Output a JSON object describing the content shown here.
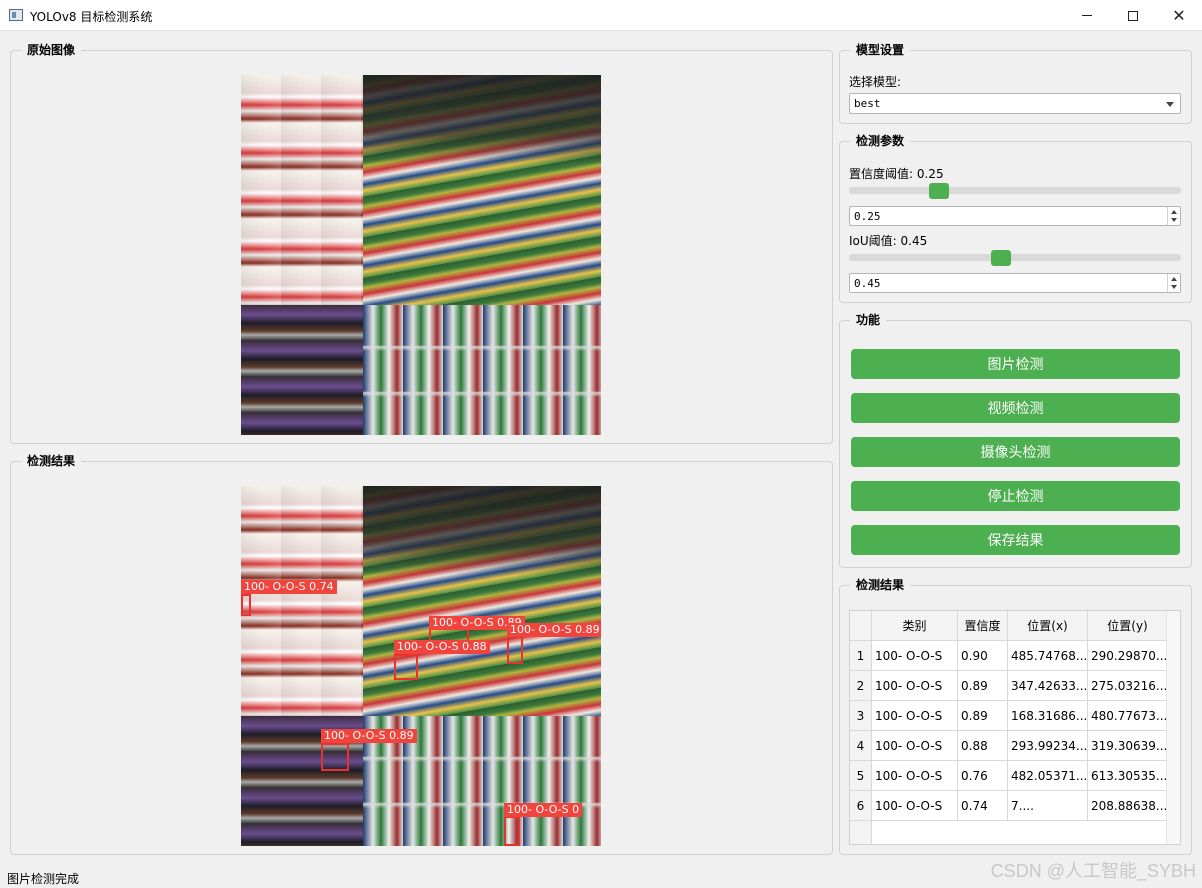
{
  "window": {
    "title": "YOLOv8 目标检测系统"
  },
  "original_image": {
    "title": "原始图像"
  },
  "result_image": {
    "title": "检测结果",
    "detections": [
      {
        "label": "100- O-O-S 0.74"
      },
      {
        "label": "100- O-O-S 0.89"
      },
      {
        "label": "100- O-O-S 0.88"
      },
      {
        "label": "100- O-O-S 0.89"
      },
      {
        "label": "100- O-O-S 0.89"
      },
      {
        "label": "100- O-O-S 0"
      }
    ]
  },
  "model_settings": {
    "title": "模型设置",
    "select_label": "选择模型:",
    "selected_model": "best"
  },
  "detection_params": {
    "title": "检测参数",
    "confidence": {
      "label": "置信度阈值: 0.25",
      "value": "0.25",
      "slider_fraction": 0.25
    },
    "iou": {
      "label": "IoU阈值: 0.45",
      "value": "0.45",
      "slider_fraction": 0.45
    }
  },
  "functions": {
    "title": "功能",
    "buttons": [
      "图片检测",
      "视频检测",
      "摄像头检测",
      "停止检测",
      "保存结果"
    ]
  },
  "results_table": {
    "title": "检测结果",
    "headers": [
      "类别",
      "置信度",
      "位置(x)",
      "位置(y)"
    ],
    "rows": [
      {
        "num": "1",
        "cls": "100- O-O-S",
        "conf": "0.90",
        "x": "485.74768...",
        "y": "290.29870..."
      },
      {
        "num": "2",
        "cls": "100- O-O-S",
        "conf": "0.89",
        "x": "347.42633...",
        "y": "275.03216..."
      },
      {
        "num": "3",
        "cls": "100- O-O-S",
        "conf": "0.89",
        "x": "168.31686...",
        "y": "480.77673..."
      },
      {
        "num": "4",
        "cls": "100- O-O-S",
        "conf": "0.88",
        "x": "293.99234...",
        "y": "319.30639..."
      },
      {
        "num": "5",
        "cls": "100- O-O-S",
        "conf": "0.76",
        "x": "482.05371...",
        "y": "613.30535..."
      },
      {
        "num": "6",
        "cls": "100- O-O-S",
        "conf": "0.74",
        "x": "7....",
        "y": "208.88638..."
      }
    ]
  },
  "status": {
    "text": "图片检测完成"
  },
  "watermark": "CSDN @人工智能_SYBH",
  "colors": {
    "accent_green": "#4caf50",
    "detection_red": "#e8332c"
  },
  "icons": {
    "app": "app-window-icon",
    "minimize": "minimize-icon",
    "maximize": "maximize-icon",
    "close": "close-icon",
    "dropdown": "chevron-down-icon"
  }
}
